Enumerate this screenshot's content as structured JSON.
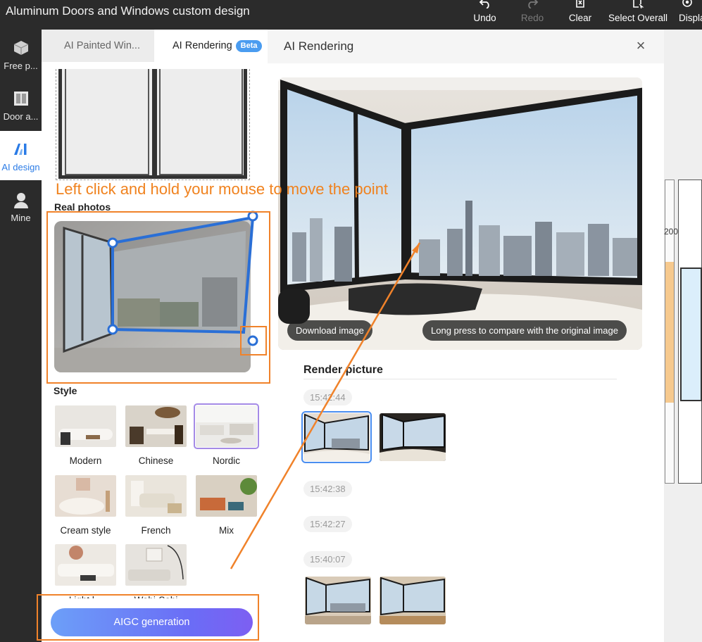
{
  "app": {
    "title": "Aluminum Doors and Windows custom design"
  },
  "toolbar": {
    "undo": "Undo",
    "redo": "Redo",
    "clear": "Clear",
    "select_overall": "Select Overall",
    "display": "Display"
  },
  "rail": {
    "items": [
      {
        "label": "Free p..."
      },
      {
        "label": "Door a..."
      },
      {
        "label": "AI design"
      },
      {
        "label": "Mine"
      }
    ]
  },
  "panel": {
    "tabs": [
      {
        "label": "AI Painted Win..."
      },
      {
        "label": "AI Rendering"
      }
    ],
    "beta": "Beta",
    "real_photos_title": "Real photos",
    "style_title": "Style",
    "styles": [
      {
        "label": "Modern"
      },
      {
        "label": "Chinese"
      },
      {
        "label": "Nordic"
      },
      {
        "label": "Cream style"
      },
      {
        "label": "French"
      },
      {
        "label": "Mix"
      },
      {
        "label": "Light l..."
      },
      {
        "label": "Wabi-Sabi"
      }
    ],
    "aigc_button": "AIGC generation"
  },
  "dialog": {
    "title": "AI Rendering",
    "download": "Download image",
    "compare": "Long press to compare with the original image",
    "render_heading": "Render picture",
    "history": [
      {
        "time": "15:42:44"
      },
      {
        "time": "15:42:38"
      },
      {
        "time": "15:42:27"
      },
      {
        "time": "15:40:07"
      }
    ]
  },
  "canvas": {
    "partial_dimension": "200"
  },
  "annotation": {
    "instruction": "Left click and hold your mouse to move the point"
  },
  "colors": {
    "accent": "#2a7be6",
    "annotation": "#f0821e",
    "selection": "#a48ae6"
  }
}
